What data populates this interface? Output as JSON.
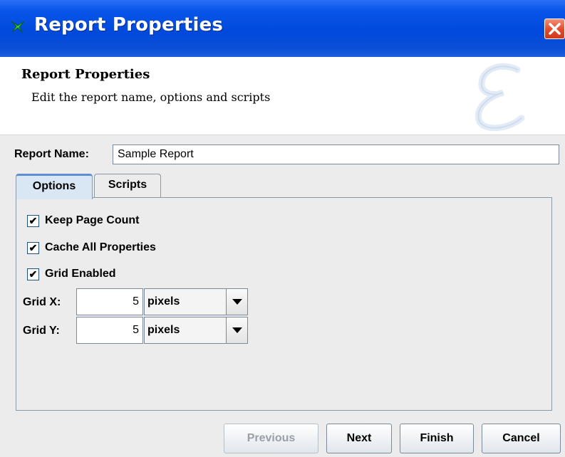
{
  "window": {
    "title": "Report Properties"
  },
  "header": {
    "title": "Report Properties",
    "subtitle": "Edit the report name, options and scripts"
  },
  "report_name": {
    "label": "Report Name:",
    "value": "Sample Report"
  },
  "tabs": [
    {
      "label": "Options",
      "selected": true
    },
    {
      "label": "Scripts",
      "selected": false
    }
  ],
  "options": {
    "keep_page_count": {
      "label": "Keep Page Count",
      "checked": true
    },
    "cache_all_properties": {
      "label": "Cache All Properties",
      "checked": true
    },
    "grid_enabled": {
      "label": "Grid Enabled",
      "checked": true
    },
    "grid_x": {
      "label": "Grid X:",
      "value": "5",
      "unit": "pixels"
    },
    "grid_y": {
      "label": "Grid Y:",
      "value": "5",
      "unit": "pixels"
    }
  },
  "buttons": {
    "previous": "Previous",
    "next": "Next",
    "finish": "Finish",
    "cancel": "Cancel"
  },
  "checkmark": "✔"
}
